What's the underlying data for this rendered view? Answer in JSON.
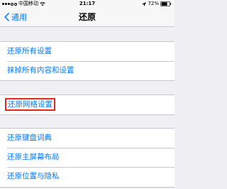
{
  "status_bar": {
    "carrier": "中国移动",
    "time": "21:17",
    "battery_percent": "72%",
    "signal_bars_filled": 3,
    "signal_bars_total": 5
  },
  "nav": {
    "back_label": "通用",
    "title": "还原"
  },
  "groups": [
    {
      "items": [
        "还原所有设置",
        "抹掉所有内容和设置"
      ]
    },
    {
      "items": [
        "还原网络设置"
      ]
    },
    {
      "items": [
        "还原键盘词典",
        "还原主屏幕布局",
        "还原位置与隐私"
      ]
    }
  ],
  "highlighted_item": "还原网络设置",
  "colors": {
    "accent": "#007aff",
    "highlight": "#e5261f",
    "background": "#efeff4"
  },
  "icons": [
    "wifi-icon",
    "location-icon",
    "battery-icon",
    "chevron-left-icon"
  ]
}
